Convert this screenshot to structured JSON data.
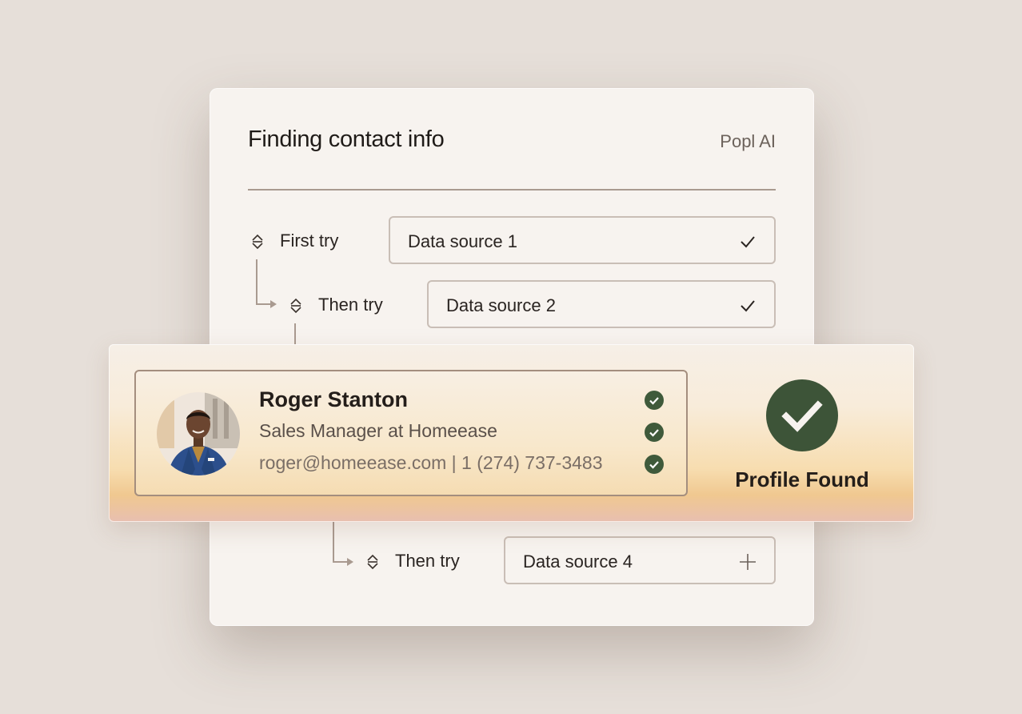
{
  "panel": {
    "title": "Finding contact info",
    "brand": "Popl AI"
  },
  "steps": [
    {
      "label": "First try",
      "source": "Data source 1",
      "status_icon": "check-icon"
    },
    {
      "label": "Then try",
      "source": "Data source 2",
      "status_icon": "check-icon"
    },
    {
      "label": "Then try",
      "source": "Data source 4",
      "status_icon": "plus-icon"
    }
  ],
  "profile": {
    "name": "Roger Stanton",
    "role": "Sales Manager at Homeease",
    "contact": "roger@homeease.com | 1 (274) 737-3483",
    "avatar_icon": "person-photo"
  },
  "result": {
    "label": "Profile Found"
  },
  "colors": {
    "background": "#e6dfd9",
    "panel": "#f7f3ef",
    "accent_green": "#3d5438",
    "card_border": "#a48e7e",
    "band_gradient_end": "#f0c890"
  }
}
